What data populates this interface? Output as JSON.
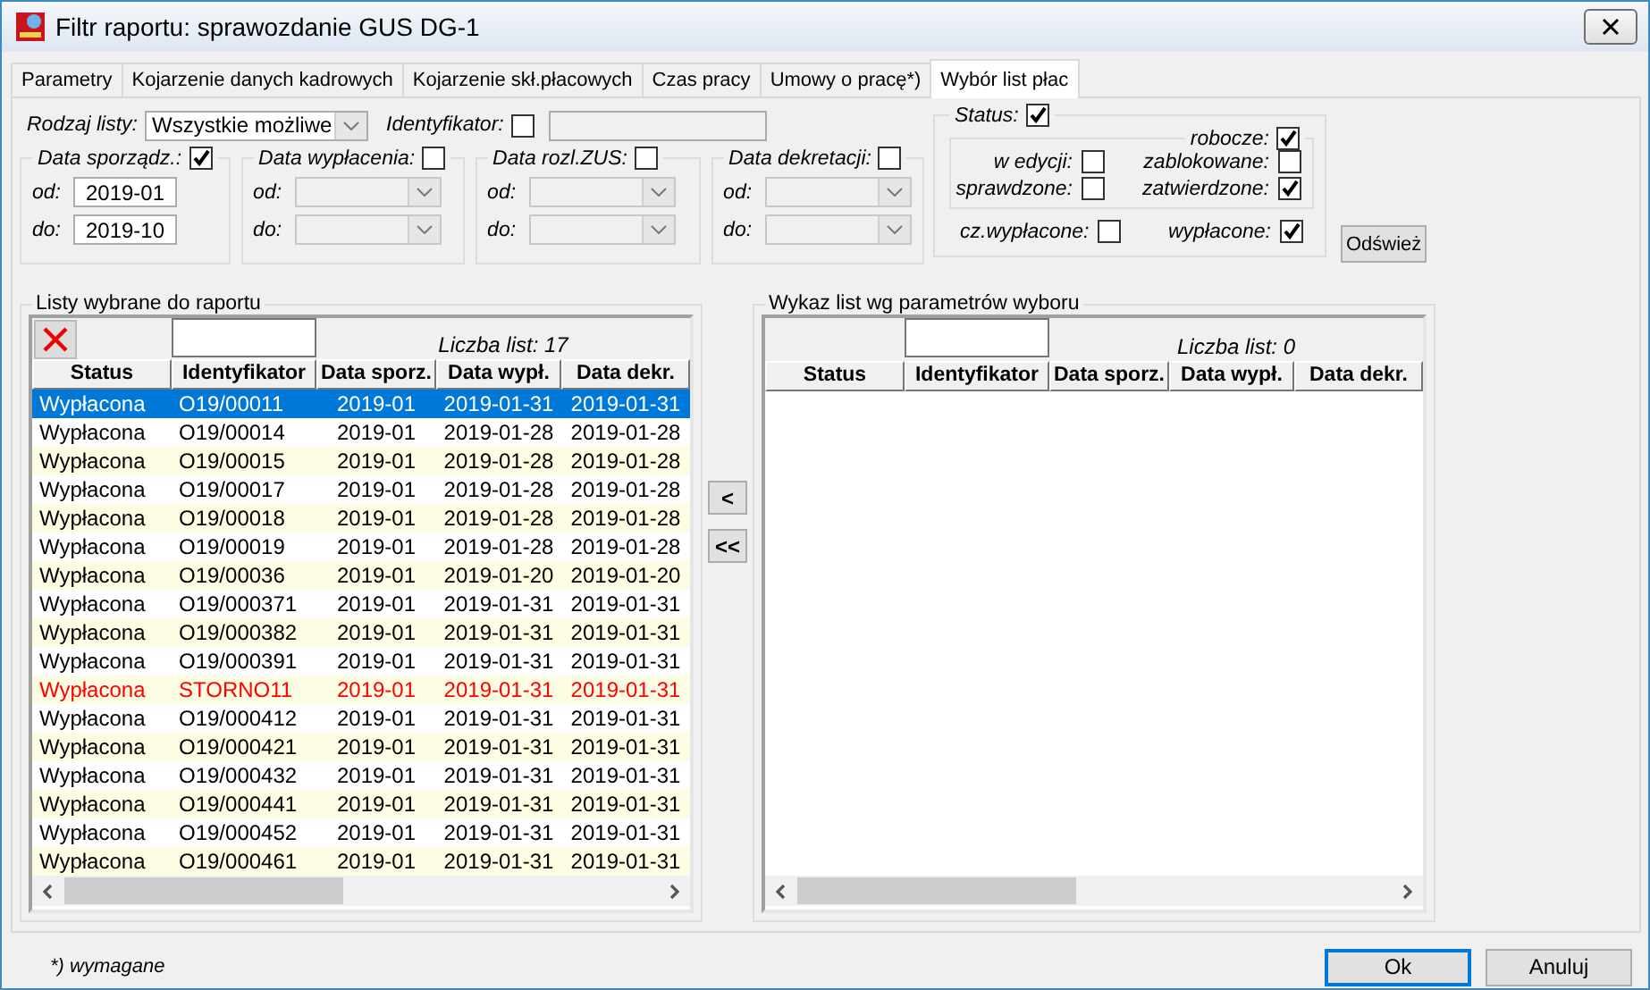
{
  "window": {
    "title": "Filtr raportu: sprawozdanie GUS DG-1"
  },
  "tabs": [
    {
      "label": "Parametry",
      "selected": false
    },
    {
      "label": "Kojarzenie danych kadrowych",
      "selected": false
    },
    {
      "label": "Kojarzenie skł.płacowych",
      "selected": false
    },
    {
      "label": "Czas pracy",
      "selected": false
    },
    {
      "label": "Umowy o pracę*)",
      "selected": false
    },
    {
      "label": "Wybór list płac",
      "selected": true
    }
  ],
  "list_type": {
    "label": "Rodzaj listy:",
    "value": "Wszystkie możliwe"
  },
  "identifier": {
    "label": "Identyfikator:",
    "checked": false
  },
  "date_groups": [
    {
      "label": "Data sporządz.:",
      "checked": true,
      "kind": "text",
      "disabled": false,
      "from": {
        "label": "od:",
        "value": "2019-01"
      },
      "to": {
        "label": "do:",
        "value": "2019-10"
      }
    },
    {
      "label": "Data wypłacenia:",
      "checked": false,
      "kind": "dropdown",
      "disabled": true,
      "from": {
        "label": "od:"
      },
      "to": {
        "label": "do:"
      }
    },
    {
      "label": "Data rozl.ZUS:",
      "checked": false,
      "kind": "dropdown",
      "disabled": true,
      "from": {
        "label": "od:"
      },
      "to": {
        "label": "do:"
      }
    },
    {
      "label": "Data dekretacji:",
      "checked": false,
      "kind": "dropdown",
      "disabled": true,
      "from": {
        "label": "od:"
      },
      "to": {
        "label": "do:"
      }
    }
  ],
  "status": {
    "label": "Status:",
    "checked": true,
    "draft": {
      "label": "robocze:",
      "checked": true
    },
    "draft_options": [
      {
        "label": "w edycji:",
        "checked": false
      },
      {
        "label": "zablokowane:",
        "checked": false
      },
      {
        "label": "sprawdzone:",
        "checked": false
      },
      {
        "label": "zatwierdzone:",
        "checked": true
      }
    ],
    "options": [
      {
        "label": "cz.wypłacone:",
        "checked": false
      },
      {
        "label": "wypłacone:",
        "checked": true
      }
    ]
  },
  "refresh_button": "Odśwież",
  "selected_lists": {
    "title": "Listy wybrane do raportu",
    "count": "Liczba list: 17",
    "columns": [
      "Status",
      "Identyfikator",
      "Data sporz.",
      "Data wypł.",
      "Data dekr."
    ],
    "rows": [
      {
        "cells": [
          "Wypłacona",
          "O19/00011",
          "2019-01",
          "2019-01-31",
          "2019-01-31"
        ],
        "selected": true,
        "cancelled": false
      },
      {
        "cells": [
          "Wypłacona",
          "O19/00014",
          "2019-01",
          "2019-01-28",
          "2019-01-28"
        ],
        "selected": false,
        "cancelled": false
      },
      {
        "cells": [
          "Wypłacona",
          "O19/00015",
          "2019-01",
          "2019-01-28",
          "2019-01-28"
        ],
        "selected": false,
        "cancelled": false
      },
      {
        "cells": [
          "Wypłacona",
          "O19/00017",
          "2019-01",
          "2019-01-28",
          "2019-01-28"
        ],
        "selected": false,
        "cancelled": false
      },
      {
        "cells": [
          "Wypłacona",
          "O19/00018",
          "2019-01",
          "2019-01-28",
          "2019-01-28"
        ],
        "selected": false,
        "cancelled": false
      },
      {
        "cells": [
          "Wypłacona",
          "O19/00019",
          "2019-01",
          "2019-01-28",
          "2019-01-28"
        ],
        "selected": false,
        "cancelled": false
      },
      {
        "cells": [
          "Wypłacona",
          "O19/00036",
          "2019-01",
          "2019-01-20",
          "2019-01-20"
        ],
        "selected": false,
        "cancelled": false
      },
      {
        "cells": [
          "Wypłacona",
          "O19/000371",
          "2019-01",
          "2019-01-31",
          "2019-01-31"
        ],
        "selected": false,
        "cancelled": false
      },
      {
        "cells": [
          "Wypłacona",
          "O19/000382",
          "2019-01",
          "2019-01-31",
          "2019-01-31"
        ],
        "selected": false,
        "cancelled": false
      },
      {
        "cells": [
          "Wypłacona",
          "O19/000391",
          "2019-01",
          "2019-01-31",
          "2019-01-31"
        ],
        "selected": false,
        "cancelled": false
      },
      {
        "cells": [
          "Wypłacona",
          "STORNO11",
          "2019-01",
          "2019-01-31",
          "2019-01-31"
        ],
        "selected": false,
        "cancelled": true
      },
      {
        "cells": [
          "Wypłacona",
          "O19/000412",
          "2019-01",
          "2019-01-31",
          "2019-01-31"
        ],
        "selected": false,
        "cancelled": false
      },
      {
        "cells": [
          "Wypłacona",
          "O19/000421",
          "2019-01",
          "2019-01-31",
          "2019-01-31"
        ],
        "selected": false,
        "cancelled": false
      },
      {
        "cells": [
          "Wypłacona",
          "O19/000432",
          "2019-01",
          "2019-01-31",
          "2019-01-31"
        ],
        "selected": false,
        "cancelled": false
      },
      {
        "cells": [
          "Wypłacona",
          "O19/000441",
          "2019-01",
          "2019-01-31",
          "2019-01-31"
        ],
        "selected": false,
        "cancelled": false
      },
      {
        "cells": [
          "Wypłacona",
          "O19/000452",
          "2019-01",
          "2019-01-31",
          "2019-01-31"
        ],
        "selected": false,
        "cancelled": false
      },
      {
        "cells": [
          "Wypłacona",
          "O19/000461",
          "2019-01",
          "2019-01-31",
          "2019-01-31"
        ],
        "selected": false,
        "cancelled": false
      }
    ]
  },
  "move_buttons": [
    "<",
    "<<"
  ],
  "available_lists": {
    "title": "Wykaz list wg parametrów wyboru",
    "count": "Liczba list: 0",
    "columns": [
      "Status",
      "Identyfikator",
      "Data sporz.",
      "Data wypł.",
      "Data dekr."
    ]
  },
  "footnote": "*) wymagane",
  "buttons": [
    {
      "label": "Ok",
      "kind": "default"
    },
    {
      "label": "Anuluj",
      "kind": "normal"
    }
  ]
}
